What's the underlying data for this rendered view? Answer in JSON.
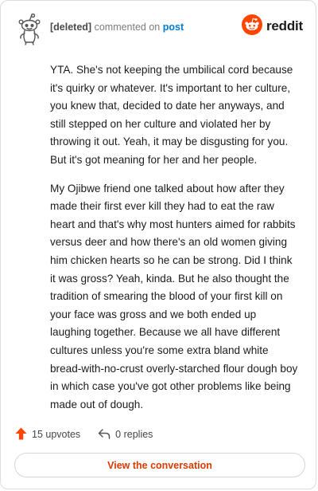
{
  "comment": {
    "author": "[deleted]",
    "action_text": "commented on",
    "target_text": "post",
    "paragraphs": [
      "YTA. She's not keeping the umbilical cord because it's quirky or whatever. It's important to her culture, you knew that, decided to date her anyways, and still stepped on her culture and violated her by throwing it out. Yeah, it may be disgusting for you. But it's got meaning for her and her people.",
      "My Ojibwe friend one talked about how after they made their first ever kill they had to eat the raw heart and that's why most hunters aimed for rabbits versus deer and how there's an old women giving him chicken hearts so he can be strong. Did I think it was gross? Yeah, kinda. But he also thought the tradition of smearing the blood of your first kill on your face was gross and we both ended up laughing together. Because we all have different cultures unless you're some extra bland white bread-with-no-crust overly-starched flour dough boy in which case you've got other problems like being made out of dough."
    ]
  },
  "brand": {
    "wordmark": "reddit",
    "icon": "reddit-logo-icon",
    "color": "#ff4500"
  },
  "stats": {
    "upvotes_label": "15 upvotes",
    "replies_label": "0 replies",
    "upvote_icon": "upvote-arrow-icon",
    "reply_icon": "reply-arrow-icon",
    "upvote_color": "#ff4500"
  },
  "actions": {
    "view_conversation_label": "View the conversation",
    "label_color": "#d93a00"
  },
  "colors": {
    "link": "#0079d3",
    "border": "#dcdcdc"
  }
}
